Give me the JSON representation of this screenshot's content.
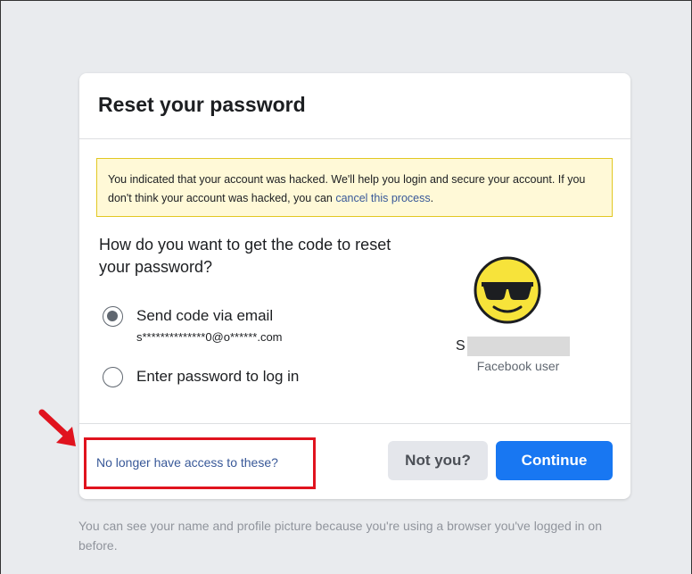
{
  "dialog": {
    "title": "Reset your password",
    "notice": {
      "text": "You indicated that your account was hacked. We'll help you login and secure your account. If you don't think your account was hacked, you can ",
      "link": "cancel this process",
      "end": "."
    },
    "question": "How do you want to get the code to reset your password?",
    "options": [
      {
        "label": "Send code via email",
        "detail": "s**************0@o******.com",
        "selected": true
      },
      {
        "label": "Enter password to log in",
        "selected": false
      }
    ],
    "profile": {
      "name_initial": "S",
      "subtitle": "Facebook user"
    },
    "footer": {
      "no_access_link": "No longer have access to these?",
      "not_you_label": "Not you?",
      "continue_label": "Continue"
    }
  },
  "bottom_note": "You can see your name and profile picture because you're using a browser you've logged in on before.",
  "colors": {
    "primary": "#1877f2",
    "link": "#385898",
    "highlight_border": "#e0131e",
    "notice_bg": "#fff9d7"
  },
  "icons": {
    "avatar": "sunglasses-emoji-icon",
    "annotation": "red-arrow-icon"
  }
}
